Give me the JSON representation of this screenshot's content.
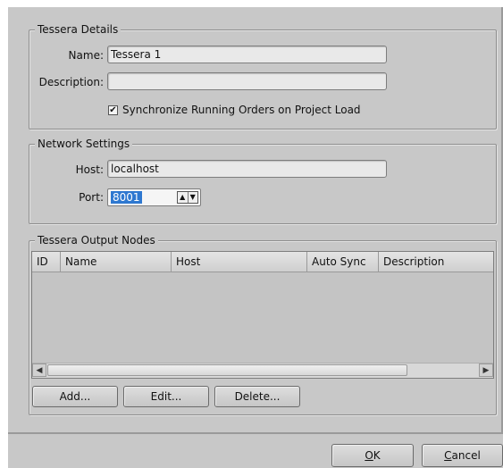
{
  "details": {
    "legend": "Tessera Details",
    "name_label": "Name:",
    "name_value": "Tessera 1",
    "description_label": "Description:",
    "description_value": "",
    "sync_checked": true,
    "sync_label": "Synchronize Running Orders on Project Load"
  },
  "network": {
    "legend": "Network Settings",
    "host_label": "Host:",
    "host_value": "localhost",
    "port_label": "Port:",
    "port_value": "8001"
  },
  "output_nodes": {
    "legend": "Tessera Output Nodes",
    "columns": [
      "ID",
      "Name",
      "Host",
      "Auto Sync",
      "Description"
    ],
    "rows": [],
    "add_label": "Add...",
    "edit_label": "Edit...",
    "delete_label": "Delete..."
  },
  "footer": {
    "ok_mnemonic": "O",
    "ok_rest": "K",
    "cancel_mnemonic": "C",
    "cancel_rest": "ancel"
  },
  "icons": {
    "check": "check-icon",
    "spin_up": "caret-up-icon",
    "spin_down": "caret-down-icon",
    "scroll_left": "scroll-left-icon",
    "scroll_right": "scroll-right-icon"
  }
}
